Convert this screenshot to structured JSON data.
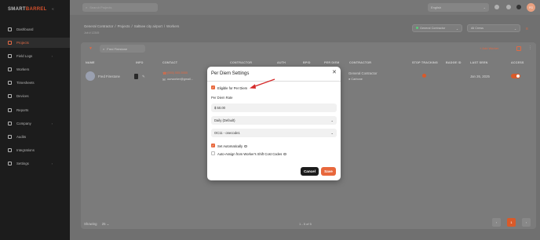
{
  "brand": {
    "logo_part1": "SMART",
    "logo_part2": "BARREL",
    "logo_toggle": "«"
  },
  "sidebar": {
    "items": [
      {
        "label": "Dashboard",
        "icon": "dashboard-icon"
      },
      {
        "label": "Projects",
        "icon": "folder-icon",
        "active": true
      },
      {
        "label": "Field Logs",
        "icon": "clipboard-icon",
        "chevron": true
      },
      {
        "label": "Workers",
        "icon": "users-icon"
      },
      {
        "label": "Timesheets",
        "icon": "clock-icon"
      },
      {
        "label": "Devices",
        "icon": "device-icon"
      },
      {
        "label": "Reports",
        "icon": "report-icon"
      },
      {
        "label": "Company",
        "icon": "building-icon",
        "chevron": true
      },
      {
        "label": "Audits",
        "icon": "audit-icon"
      },
      {
        "label": "Integrations",
        "icon": "plug-icon"
      },
      {
        "label": "Settings",
        "icon": "gear-icon",
        "chevron": true
      }
    ]
  },
  "topbar": {
    "search_placeholder": "Search Projects",
    "language": "English",
    "avatar_initials": "FG"
  },
  "breadcrumb": {
    "items": [
      "General Contractor",
      "/",
      "Projects",
      "/",
      "Saltsee city airport",
      "/",
      "Workers"
    ],
    "subtitle": "Job # 12345"
  },
  "filters": {
    "contractor": "General Contractor",
    "crews": "All Crews"
  },
  "table": {
    "search_value": "Fred Firestone",
    "add_button": "Add Worker",
    "columns": [
      "NAME",
      "INFO",
      "CONTACT",
      "CONTRACTOR",
      "AUTH",
      "BPID",
      "PER DIEM",
      "CONTRACTOR",
      "STOP TRACKING",
      "BADGE ID",
      "LAST SEEN",
      "ACCESS"
    ],
    "row": {
      "name": "Fred Firestone",
      "phone": "(555) 555-5555",
      "email": "ourworker@gmail...",
      "contractor": "General Contractor",
      "contractor_sub": "Carbone",
      "last_seen": "Jan 26, 2025"
    },
    "showing_label": "Showing",
    "page_size": "25",
    "page_count": "1 - 5 of 5",
    "current_page": "1"
  },
  "modal": {
    "title": "Per Diem Settings",
    "eligible_label": "Eligible for Per Diem",
    "eligible_checked": true,
    "rate_label": "Per Diem Rate",
    "rate_value": "$ 50.00",
    "frequency": "Daily (Default)",
    "cost_code": "OC11 - onecode1",
    "set_auto_label": "Set Automatically",
    "set_auto_checked": true,
    "auto_assign_label": "Auto-Assign from Worker's Shift Cost Codes",
    "auto_assign_checked": false,
    "cancel_label": "Cancel",
    "save_label": "Save"
  },
  "colors": {
    "accent": "#e8683d",
    "annotation_arrow": "#d62b2b",
    "sidebar_bg": "#1c1c1c"
  }
}
